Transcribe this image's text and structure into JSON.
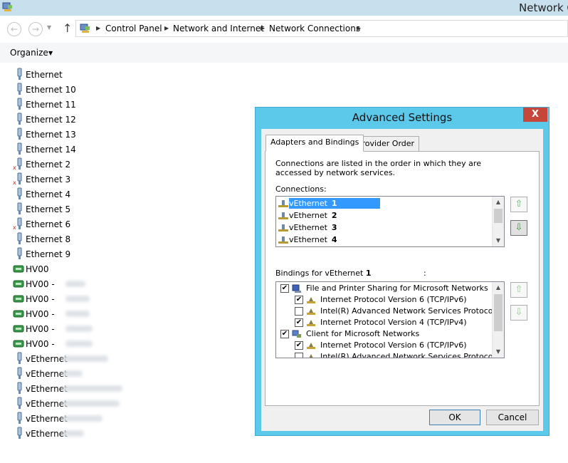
{
  "window": {
    "title": "Network C"
  },
  "address": {
    "crumbs": [
      "Control Panel",
      "Network and Internet",
      "Network Connections"
    ]
  },
  "commandbar": {
    "organize": "Organize"
  },
  "connections": [
    {
      "name": "Ethernet",
      "status": "ok"
    },
    {
      "name": "Ethernet 10",
      "status": "ok"
    },
    {
      "name": "Ethernet 11",
      "status": "ok"
    },
    {
      "name": "Ethernet 12",
      "status": "ok"
    },
    {
      "name": "Ethernet 13",
      "status": "ok"
    },
    {
      "name": "Ethernet 14",
      "status": "ok"
    },
    {
      "name": "Ethernet 2",
      "status": "disconnected"
    },
    {
      "name": "Ethernet 3",
      "status": "disconnected"
    },
    {
      "name": "Ethernet 4",
      "status": "ok"
    },
    {
      "name": "Ethernet 5",
      "status": "ok"
    },
    {
      "name": "Ethernet 6",
      "status": "disconnected"
    },
    {
      "name": "Ethernet 8",
      "status": "ok"
    },
    {
      "name": "Ethernet 9",
      "status": "ok"
    },
    {
      "name": "HV00",
      "status": "team"
    },
    {
      "name": "HV00 -",
      "status": "team",
      "redacted": true
    },
    {
      "name": "HV00 -",
      "status": "team",
      "redacted": true
    },
    {
      "name": "HV00 -",
      "status": "team",
      "redacted": true
    },
    {
      "name": "HV00 -",
      "status": "team",
      "redacted": true
    },
    {
      "name": "HV00 -",
      "status": "team",
      "redacted": true
    },
    {
      "name": "vEthernet",
      "status": "ok",
      "redacted": true
    },
    {
      "name": "vEthernet",
      "status": "ok",
      "redacted": true
    },
    {
      "name": "vEthernet",
      "status": "ok",
      "redacted": true
    },
    {
      "name": "vEthernet",
      "status": "ok",
      "redacted": true
    },
    {
      "name": "vEthernet",
      "status": "ok",
      "redacted": true
    },
    {
      "name": "vEthernet",
      "status": "ok",
      "redacted": true
    }
  ],
  "dialog": {
    "title": "Advanced Settings",
    "close": "X",
    "tabs": [
      "Adapters and Bindings",
      "Provider Order"
    ],
    "description": "Connections are listed in the order in which they are accessed by network services.",
    "connections_label": "Connections:",
    "connection_items": [
      {
        "name": "vEthernet",
        "num": "1",
        "selected": true
      },
      {
        "name": "vEthernet",
        "num": "2",
        "selected": false
      },
      {
        "name": "vEthernet",
        "num": "3",
        "selected": false
      },
      {
        "name": "vEthernet",
        "num": "4",
        "selected": false
      }
    ],
    "bindings_label": "Bindings for vEthernet",
    "bindings_num": "1",
    "bindings_suffix": ":",
    "bindings": [
      {
        "label": "File and Printer Sharing for Microsoft Networks",
        "checked": true,
        "level": 0,
        "icon": "service"
      },
      {
        "label": "Internet Protocol Version 6 (TCP/IPv6)",
        "checked": true,
        "level": 1,
        "icon": "protocol"
      },
      {
        "label": "Intel(R) Advanced Network Services Protocol",
        "checked": false,
        "level": 1,
        "icon": "protocol"
      },
      {
        "label": "Internet Protocol Version 4 (TCP/IPv4)",
        "checked": true,
        "level": 1,
        "icon": "protocol"
      },
      {
        "label": "Client for Microsoft Networks",
        "checked": true,
        "level": 0,
        "icon": "client"
      },
      {
        "label": "Internet Protocol Version 6 (TCP/IPv6)",
        "checked": true,
        "level": 1,
        "icon": "protocol"
      },
      {
        "label": "Intel(R) Advanced Network Services Protocol",
        "checked": false,
        "level": 1,
        "icon": "protocol"
      }
    ],
    "ok": "OK",
    "cancel": "Cancel"
  },
  "icons": {
    "nav_back": "arrow-left-icon",
    "nav_forward": "arrow-right-icon",
    "nav_up": "arrow-up-icon",
    "move_up": "green-arrow-up-icon",
    "move_down": "green-arrow-down-icon"
  },
  "colors": {
    "title_bar": "#c8dfee",
    "dialog_frame": "#5cc8ea",
    "close_button": "#c7463a",
    "selection": "#3399ff"
  }
}
